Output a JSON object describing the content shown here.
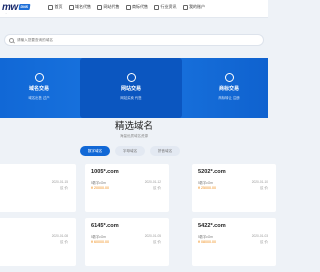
{
  "header": {
    "logo_text": "mw",
    "logo_badge": "DNS",
    "logo_sub": "...",
    "nav": [
      "首页",
      "域名代售",
      "网站代售",
      "商标代售",
      "行业资讯",
      "我的账户"
    ]
  },
  "search": {
    "placeholder": "请输入您要查询的域名"
  },
  "services": [
    {
      "title": "域名交易",
      "sub": "域名出售  过户"
    },
    {
      "title": "网站交易",
      "sub": "网站买卖  代售"
    },
    {
      "title": "商标交易",
      "sub": "商标转让  注册"
    }
  ],
  "section": {
    "title": "精选域名",
    "subtitle": "海量优质域名资源",
    "tabs": [
      "数字域名",
      "字母域名",
      "拼音域名"
    ]
  },
  "domains": [
    {
      "name": "",
      "tag": "",
      "date": "2020-01-15",
      "price": "",
      "label": "议 价"
    },
    {
      "name": "1005*.com",
      "tag": "5数字cOm",
      "date": "2020-01-12",
      "price": "¥ 20000.00",
      "label": "议 价"
    },
    {
      "name": "5202*.com",
      "tag": "5数字cOm",
      "date": "2020-01-10",
      "price": "¥ 25000.00",
      "label": "议 价"
    },
    {
      "name": "",
      "tag": "",
      "date": "2020-01-08",
      "price": "",
      "label": "议 价"
    },
    {
      "name": "6145*.com",
      "tag": "5数字cOm",
      "date": "2020-01-05",
      "price": "¥ 60000.00",
      "label": "议 价"
    },
    {
      "name": "5422*.com",
      "tag": "5数字cOm",
      "date": "2020-01-03",
      "price": "¥ 08000.00",
      "label": "议 价"
    }
  ]
}
